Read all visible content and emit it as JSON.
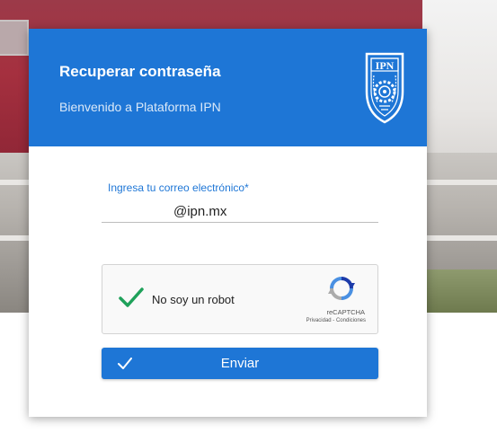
{
  "header": {
    "title": "Recuperar contraseña",
    "subtitle": "Bienvenido a Plataforma IPN",
    "logo_text": "IPN"
  },
  "form": {
    "email_label": "Ingresa tu correo electrónico*",
    "email_value": "@ipn.mx"
  },
  "captcha": {
    "label": "No soy un robot",
    "brand": "reCAPTCHA",
    "links": "Privacidad - Condiciones",
    "checked": true
  },
  "submit": {
    "label": "Enviar"
  },
  "colors": {
    "primary": "#1e76d6",
    "check_green": "#1fa15a",
    "white": "#ffffff"
  },
  "icons": {
    "logo": "ipn-shield-logo",
    "captcha_check": "check-icon",
    "captcha_logo": "recaptcha-icon",
    "submit_icon": "check-icon"
  }
}
